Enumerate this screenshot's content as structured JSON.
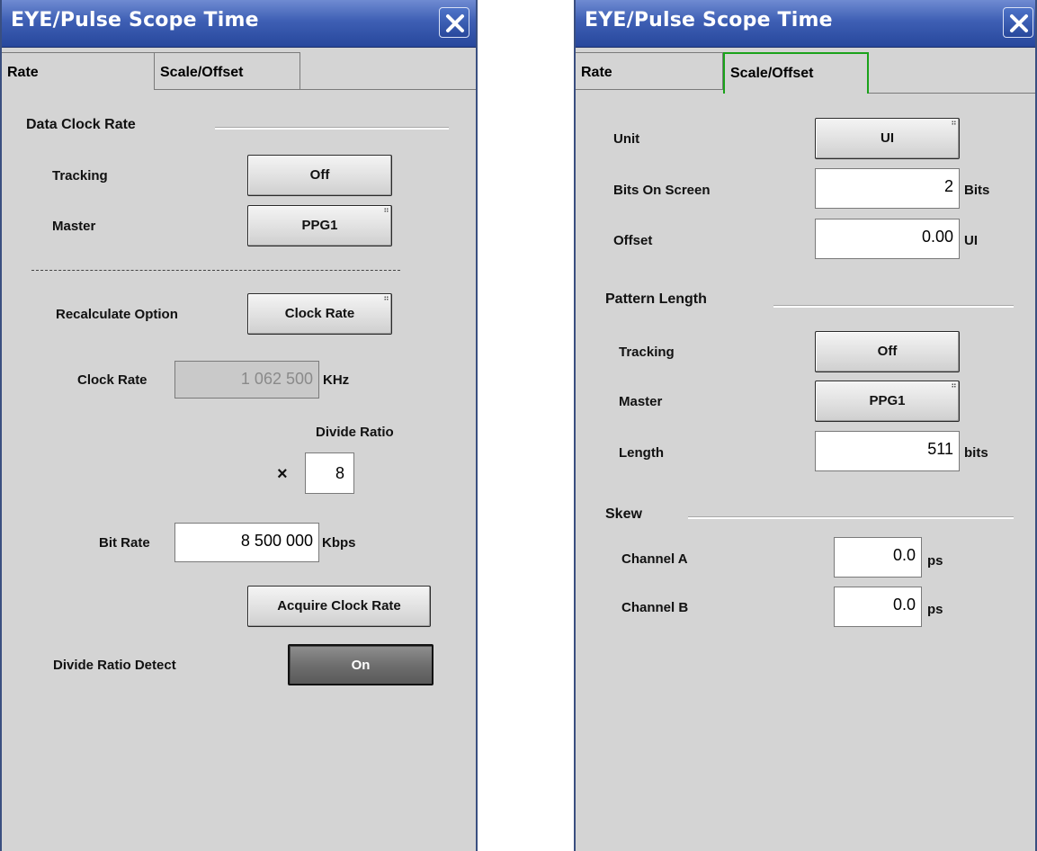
{
  "left": {
    "title": "EYE/Pulse Scope Time",
    "tabs": [
      {
        "label": "Rate"
      },
      {
        "label": "Scale/Offset"
      }
    ],
    "data_clock_rate": {
      "section": "Data Clock Rate",
      "tracking_label": "Tracking",
      "tracking_value": "Off",
      "master_label": "Master",
      "master_value": "PPG1"
    },
    "recalculate_label": "Recalculate Option",
    "recalculate_value": "Clock Rate",
    "clock_rate_label": "Clock Rate",
    "clock_rate_value": "1 062 500",
    "clock_rate_unit": "KHz",
    "divide_ratio_label": "Divide Ratio",
    "times_symbol": "×",
    "divide_ratio_value": "8",
    "bit_rate_label": "Bit Rate",
    "bit_rate_value": "8 500 000",
    "bit_rate_unit": "Kbps",
    "acquire_button": "Acquire Clock Rate",
    "divide_detect_label": "Divide Ratio Detect",
    "divide_detect_value": "On"
  },
  "right": {
    "title": "EYE/Pulse Scope Time",
    "tabs": [
      {
        "label": "Rate"
      },
      {
        "label": "Scale/Offset"
      }
    ],
    "unit_label": "Unit",
    "unit_value": "UI",
    "bits_label": "Bits On Screen",
    "bits_value": "2",
    "bits_unit": "Bits",
    "offset_label": "Offset",
    "offset_value": "0.00",
    "offset_unit": "UI",
    "pattern": {
      "section": "Pattern Length",
      "tracking_label": "Tracking",
      "tracking_value": "Off",
      "master_label": "Master",
      "master_value": "PPG1",
      "length_label": "Length",
      "length_value": "511",
      "length_unit": "bits"
    },
    "skew": {
      "section": "Skew",
      "channel_a_label": "Channel A",
      "channel_a_value": "0.0",
      "channel_a_unit": "ps",
      "channel_b_label": "Channel B",
      "channel_b_value": "0.0",
      "channel_b_unit": "ps"
    }
  },
  "colors": {
    "titlebar": "#3e5fb4",
    "panel_bg": "#d4d4d4",
    "active_tab_border": "#1aa21a",
    "on_button": "#6f6f6f"
  },
  "icons": {
    "close": "close-x-icon",
    "menu_indicator": "dots-indicator-icon"
  }
}
